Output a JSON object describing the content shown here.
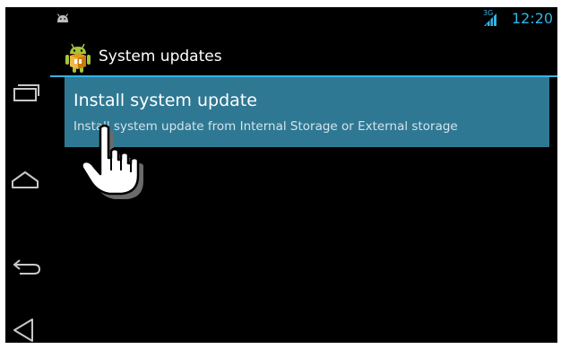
{
  "status_bar": {
    "network_label": "3G",
    "time": "12:20",
    "accent_color": "#33b5e5",
    "notification_icon": "android-notification-icon",
    "signal_icon": "cell-signal-icon"
  },
  "nav_bar": {
    "buttons": [
      {
        "name": "recent-apps",
        "icon": "recent-apps-icon"
      },
      {
        "name": "home",
        "icon": "home-icon"
      },
      {
        "name": "back",
        "icon": "back-icon"
      },
      {
        "name": "menu",
        "icon": "menu-icon"
      }
    ]
  },
  "action_bar": {
    "title": "System updates",
    "icon": "system-update-app-icon"
  },
  "preferences": [
    {
      "title": "Install system update",
      "summary": "Install system update from Internal Storage or External storage",
      "highlight_color": "#2f7893"
    }
  ],
  "cursor": {
    "icon": "pointing-hand-cursor-icon"
  }
}
